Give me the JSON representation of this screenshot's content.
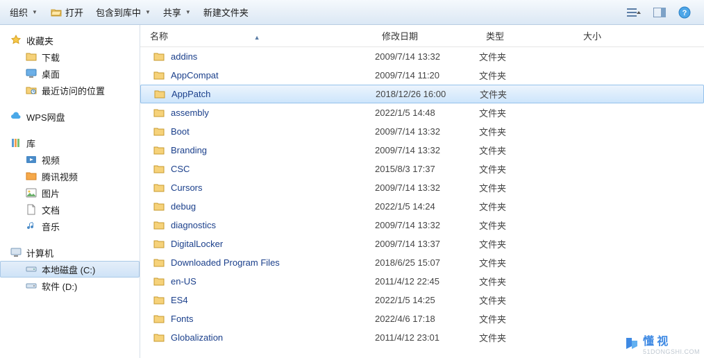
{
  "toolbar": {
    "organize": "组织",
    "open": "打开",
    "include": "包含到库中",
    "share": "共享",
    "newfolder": "新建文件夹"
  },
  "nav": {
    "fav": {
      "head": "收藏夹",
      "items": [
        "下载",
        "桌面",
        "最近访问的位置"
      ]
    },
    "wps": {
      "head": "WPS网盘"
    },
    "lib": {
      "head": "库",
      "items": [
        "视频",
        "腾讯视频",
        "图片",
        "文档",
        "音乐"
      ]
    },
    "pc": {
      "head": "计算机",
      "items": [
        "本地磁盘 (C:)",
        "软件 (D:)"
      ]
    }
  },
  "columns": {
    "name": "名称",
    "date": "修改日期",
    "type": "类型",
    "size": "大小"
  },
  "rows": [
    {
      "name": "addins",
      "date": "2009/7/14 13:32",
      "type": "文件夹"
    },
    {
      "name": "AppCompat",
      "date": "2009/7/14 11:20",
      "type": "文件夹"
    },
    {
      "name": "AppPatch",
      "date": "2018/12/26 16:00",
      "type": "文件夹",
      "selected": true
    },
    {
      "name": "assembly",
      "date": "2022/1/5 14:48",
      "type": "文件夹"
    },
    {
      "name": "Boot",
      "date": "2009/7/14 13:32",
      "type": "文件夹"
    },
    {
      "name": "Branding",
      "date": "2009/7/14 13:32",
      "type": "文件夹"
    },
    {
      "name": "CSC",
      "date": "2015/8/3 17:37",
      "type": "文件夹"
    },
    {
      "name": "Cursors",
      "date": "2009/7/14 13:32",
      "type": "文件夹"
    },
    {
      "name": "debug",
      "date": "2022/1/5 14:24",
      "type": "文件夹"
    },
    {
      "name": "diagnostics",
      "date": "2009/7/14 13:32",
      "type": "文件夹"
    },
    {
      "name": "DigitalLocker",
      "date": "2009/7/14 13:37",
      "type": "文件夹"
    },
    {
      "name": "Downloaded Program Files",
      "date": "2018/6/25 15:07",
      "type": "文件夹"
    },
    {
      "name": "en-US",
      "date": "2011/4/12 22:45",
      "type": "文件夹"
    },
    {
      "name": "ES4",
      "date": "2022/1/5 14:25",
      "type": "文件夹"
    },
    {
      "name": "Fonts",
      "date": "2022/4/6 17:18",
      "type": "文件夹"
    },
    {
      "name": "Globalization",
      "date": "2011/4/12 23:01",
      "type": "文件夹"
    }
  ],
  "watermark": {
    "text": "懂 视",
    "sub": "51DONGSHI.COM"
  }
}
